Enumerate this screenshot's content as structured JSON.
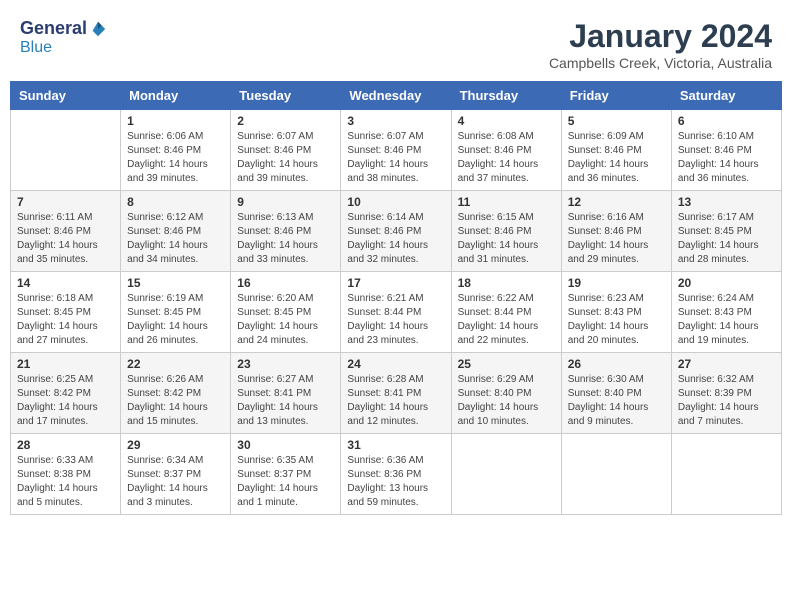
{
  "header": {
    "logo_general": "General",
    "logo_blue": "Blue",
    "month": "January 2024",
    "location": "Campbells Creek, Victoria, Australia"
  },
  "weekdays": [
    "Sunday",
    "Monday",
    "Tuesday",
    "Wednesday",
    "Thursday",
    "Friday",
    "Saturday"
  ],
  "weeks": [
    [
      {
        "day": "",
        "info": ""
      },
      {
        "day": "1",
        "info": "Sunrise: 6:06 AM\nSunset: 8:46 PM\nDaylight: 14 hours\nand 39 minutes."
      },
      {
        "day": "2",
        "info": "Sunrise: 6:07 AM\nSunset: 8:46 PM\nDaylight: 14 hours\nand 39 minutes."
      },
      {
        "day": "3",
        "info": "Sunrise: 6:07 AM\nSunset: 8:46 PM\nDaylight: 14 hours\nand 38 minutes."
      },
      {
        "day": "4",
        "info": "Sunrise: 6:08 AM\nSunset: 8:46 PM\nDaylight: 14 hours\nand 37 minutes."
      },
      {
        "day": "5",
        "info": "Sunrise: 6:09 AM\nSunset: 8:46 PM\nDaylight: 14 hours\nand 36 minutes."
      },
      {
        "day": "6",
        "info": "Sunrise: 6:10 AM\nSunset: 8:46 PM\nDaylight: 14 hours\nand 36 minutes."
      }
    ],
    [
      {
        "day": "7",
        "info": "Sunrise: 6:11 AM\nSunset: 8:46 PM\nDaylight: 14 hours\nand 35 minutes."
      },
      {
        "day": "8",
        "info": "Sunrise: 6:12 AM\nSunset: 8:46 PM\nDaylight: 14 hours\nand 34 minutes."
      },
      {
        "day": "9",
        "info": "Sunrise: 6:13 AM\nSunset: 8:46 PM\nDaylight: 14 hours\nand 33 minutes."
      },
      {
        "day": "10",
        "info": "Sunrise: 6:14 AM\nSunset: 8:46 PM\nDaylight: 14 hours\nand 32 minutes."
      },
      {
        "day": "11",
        "info": "Sunrise: 6:15 AM\nSunset: 8:46 PM\nDaylight: 14 hours\nand 31 minutes."
      },
      {
        "day": "12",
        "info": "Sunrise: 6:16 AM\nSunset: 8:46 PM\nDaylight: 14 hours\nand 29 minutes."
      },
      {
        "day": "13",
        "info": "Sunrise: 6:17 AM\nSunset: 8:45 PM\nDaylight: 14 hours\nand 28 minutes."
      }
    ],
    [
      {
        "day": "14",
        "info": "Sunrise: 6:18 AM\nSunset: 8:45 PM\nDaylight: 14 hours\nand 27 minutes."
      },
      {
        "day": "15",
        "info": "Sunrise: 6:19 AM\nSunset: 8:45 PM\nDaylight: 14 hours\nand 26 minutes."
      },
      {
        "day": "16",
        "info": "Sunrise: 6:20 AM\nSunset: 8:45 PM\nDaylight: 14 hours\nand 24 minutes."
      },
      {
        "day": "17",
        "info": "Sunrise: 6:21 AM\nSunset: 8:44 PM\nDaylight: 14 hours\nand 23 minutes."
      },
      {
        "day": "18",
        "info": "Sunrise: 6:22 AM\nSunset: 8:44 PM\nDaylight: 14 hours\nand 22 minutes."
      },
      {
        "day": "19",
        "info": "Sunrise: 6:23 AM\nSunset: 8:43 PM\nDaylight: 14 hours\nand 20 minutes."
      },
      {
        "day": "20",
        "info": "Sunrise: 6:24 AM\nSunset: 8:43 PM\nDaylight: 14 hours\nand 19 minutes."
      }
    ],
    [
      {
        "day": "21",
        "info": "Sunrise: 6:25 AM\nSunset: 8:42 PM\nDaylight: 14 hours\nand 17 minutes."
      },
      {
        "day": "22",
        "info": "Sunrise: 6:26 AM\nSunset: 8:42 PM\nDaylight: 14 hours\nand 15 minutes."
      },
      {
        "day": "23",
        "info": "Sunrise: 6:27 AM\nSunset: 8:41 PM\nDaylight: 14 hours\nand 13 minutes."
      },
      {
        "day": "24",
        "info": "Sunrise: 6:28 AM\nSunset: 8:41 PM\nDaylight: 14 hours\nand 12 minutes."
      },
      {
        "day": "25",
        "info": "Sunrise: 6:29 AM\nSunset: 8:40 PM\nDaylight: 14 hours\nand 10 minutes."
      },
      {
        "day": "26",
        "info": "Sunrise: 6:30 AM\nSunset: 8:40 PM\nDaylight: 14 hours\nand 9 minutes."
      },
      {
        "day": "27",
        "info": "Sunrise: 6:32 AM\nSunset: 8:39 PM\nDaylight: 14 hours\nand 7 minutes."
      }
    ],
    [
      {
        "day": "28",
        "info": "Sunrise: 6:33 AM\nSunset: 8:38 PM\nDaylight: 14 hours\nand 5 minutes."
      },
      {
        "day": "29",
        "info": "Sunrise: 6:34 AM\nSunset: 8:37 PM\nDaylight: 14 hours\nand 3 minutes."
      },
      {
        "day": "30",
        "info": "Sunrise: 6:35 AM\nSunset: 8:37 PM\nDaylight: 14 hours\nand 1 minute."
      },
      {
        "day": "31",
        "info": "Sunrise: 6:36 AM\nSunset: 8:36 PM\nDaylight: 13 hours\nand 59 minutes."
      },
      {
        "day": "",
        "info": ""
      },
      {
        "day": "",
        "info": ""
      },
      {
        "day": "",
        "info": ""
      }
    ]
  ]
}
